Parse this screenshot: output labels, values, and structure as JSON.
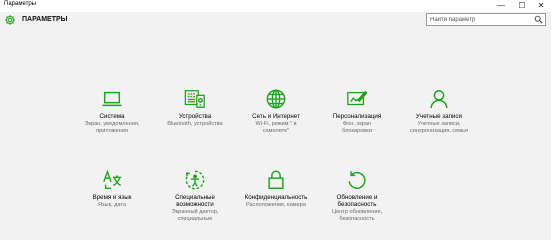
{
  "window": {
    "title": "Параметры",
    "minimize": "—",
    "maximize": "☐",
    "close": "✕"
  },
  "header": {
    "title": "ПАРАМЕТРЫ",
    "search_placeholder": "Найти параметр"
  },
  "accent_color": "#1fa31f",
  "tiles": [
    {
      "icon": "laptop-icon",
      "title": "Система",
      "desc": [
        "Экран, уведомления,",
        "приложения"
      ]
    },
    {
      "icon": "devices-icon",
      "title": "Устройства",
      "desc": [
        "Bluetooth, устройства"
      ]
    },
    {
      "icon": "globe-icon",
      "title": "Сеть и Интернет",
      "desc": [
        "Wi-Fi, режим \" в",
        "самолете\""
      ]
    },
    {
      "icon": "personalization-icon",
      "title": "Персонализация",
      "desc": [
        "Фон, экран",
        "блокировки"
      ]
    },
    {
      "icon": "person-icon",
      "title": "Учетные записи",
      "desc": [
        "Учетные записи,",
        "синхронизация, семья"
      ]
    },
    {
      "icon": "language-icon",
      "title": "Время и язык",
      "desc": [
        "Язык, дата"
      ]
    },
    {
      "icon": "accessibility-icon",
      "title": "Специальные возможности",
      "desc": [
        "Экранный диктор,",
        "специальные"
      ]
    },
    {
      "icon": "lock-icon",
      "title": "Конфиденциальность",
      "desc": [
        "Расположение, камера"
      ]
    },
    {
      "icon": "update-icon",
      "title": "Обновление и безопасность",
      "desc": [
        "Центр обновления,",
        "безопасность"
      ]
    }
  ]
}
